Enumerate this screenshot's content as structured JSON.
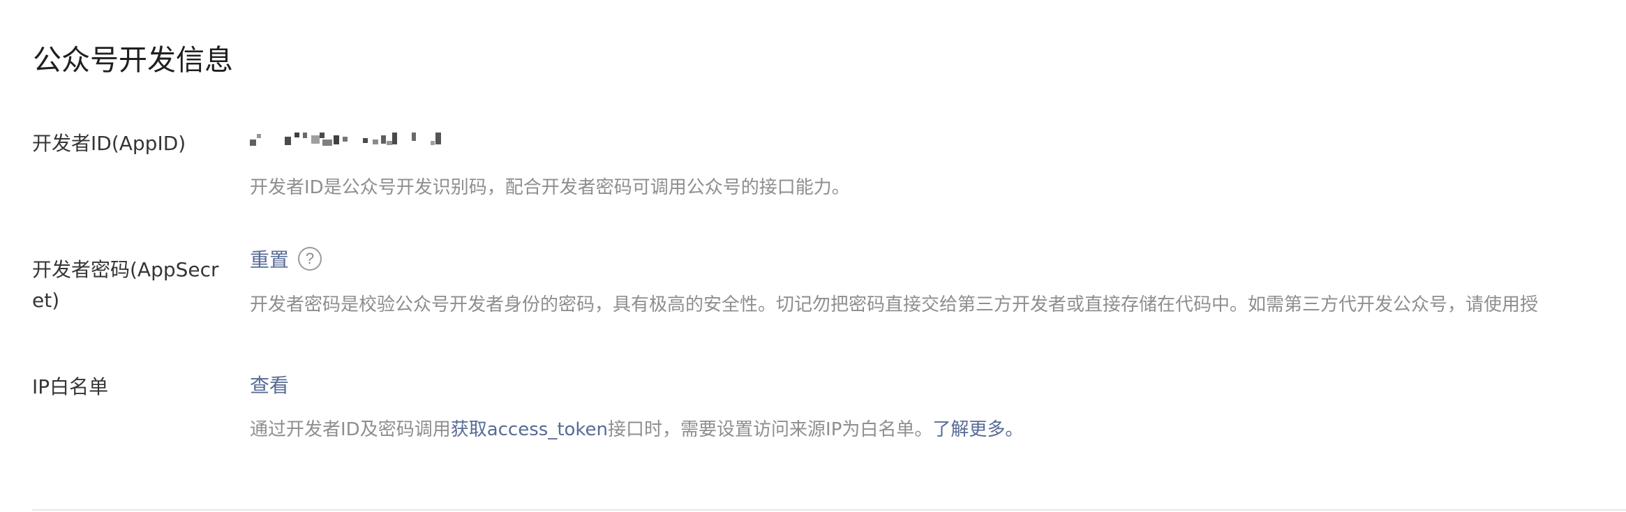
{
  "page": {
    "title": "公众号开发信息"
  },
  "appid": {
    "label": "开发者ID(AppID)",
    "description": "开发者ID是公众号开发识别码，配合开发者密码可调用公众号的接口能力。"
  },
  "appsecret": {
    "label": "开发者密码(AppSecret)",
    "reset_label": "重置",
    "help_icon": "question-circle-icon",
    "help_glyph": "?",
    "description": "开发者密码是校验公众号开发者身份的密码，具有极高的安全性。切记勿把密码直接交给第三方开发者或直接存储在代码中。如需第三方代开发公众号，请使用授"
  },
  "ip_whitelist": {
    "label": "IP白名单",
    "view_label": "查看",
    "desc_prefix": "通过开发者ID及密码调用",
    "desc_link": "获取access_token",
    "desc_middle": "接口时，需要设置访问来源IP为白名单。",
    "learn_more": "了解更多。"
  },
  "colors": {
    "link": "#576b95",
    "description": "#8e8e8e",
    "label": "#353535",
    "divider": "#e7e7eb"
  }
}
